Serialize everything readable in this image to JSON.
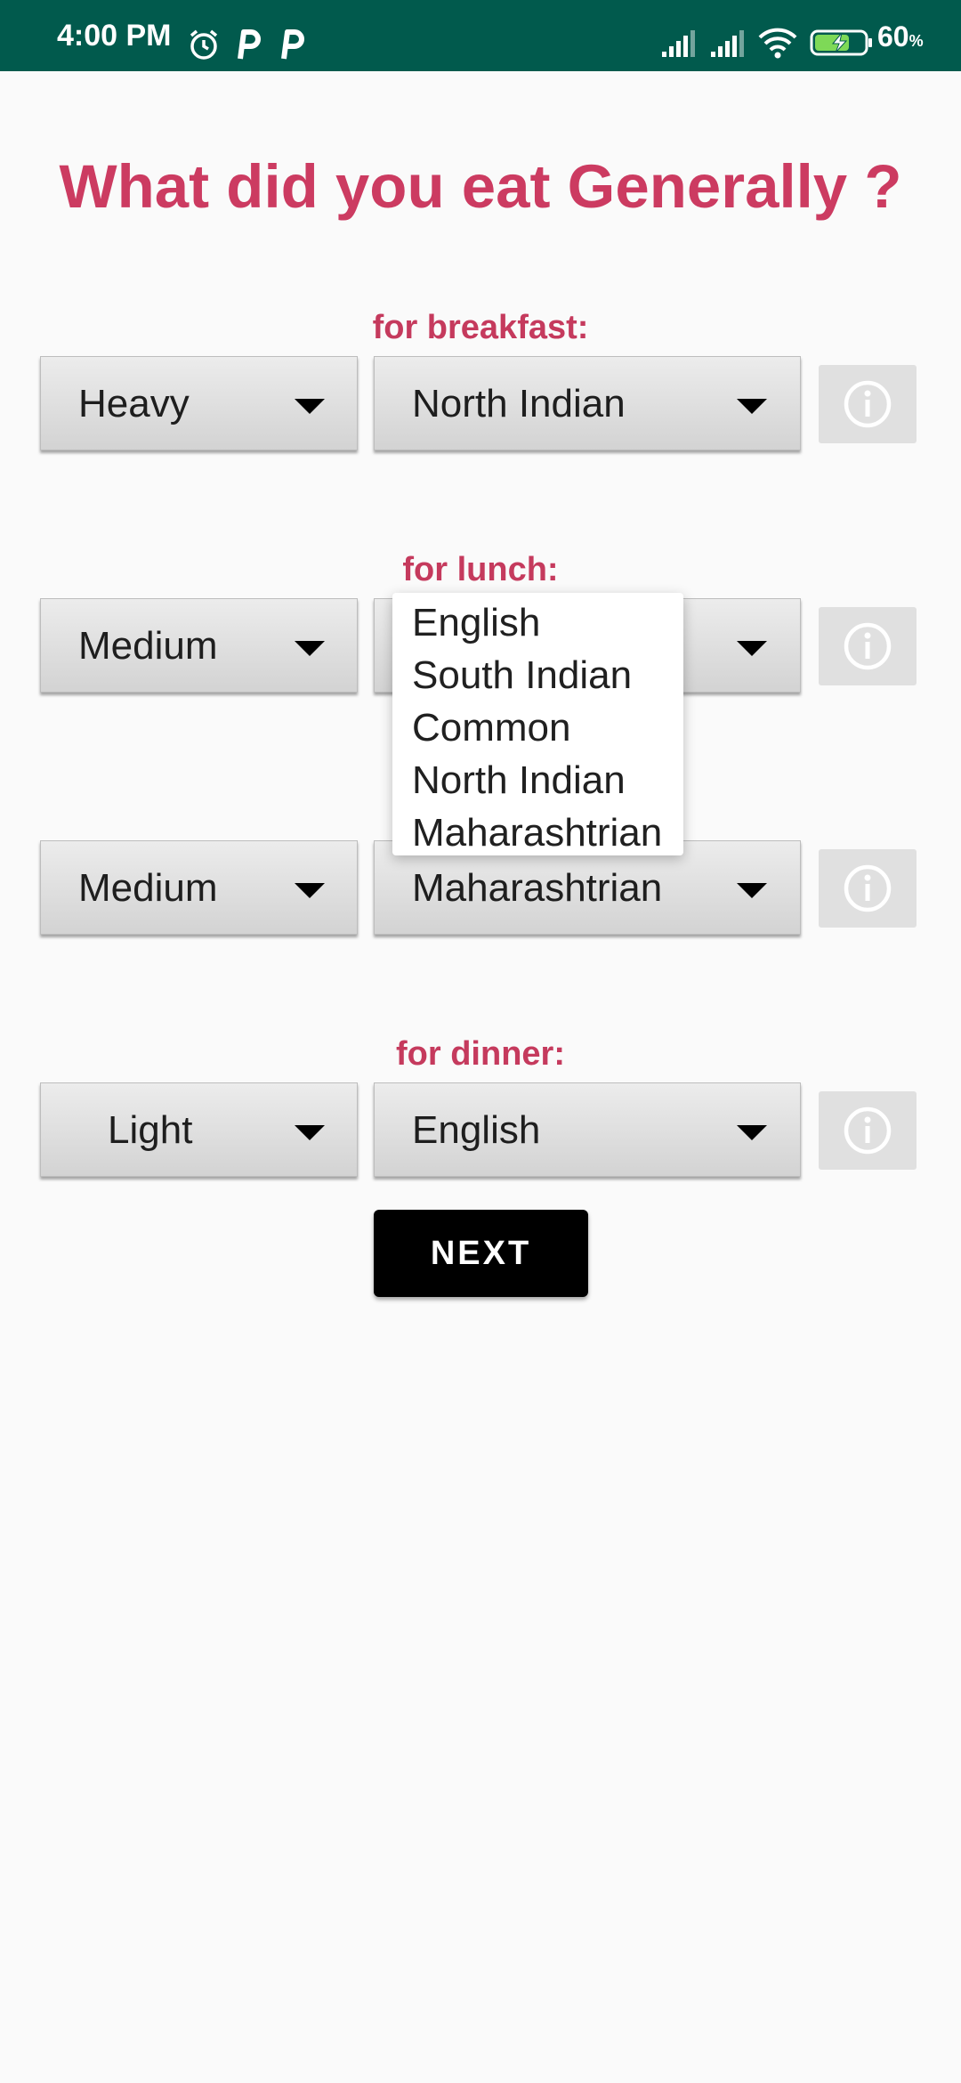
{
  "status_bar": {
    "time": "4:00 PM",
    "battery_value": "60",
    "battery_unit": "%",
    "icons": [
      "alarm-icon",
      "p-notification-icon",
      "p-notification-icon",
      "cell-signal-icon",
      "cell-signal-icon",
      "wifi-icon",
      "battery-charging-icon"
    ],
    "background": "#015a4d"
  },
  "title": "What did you eat Generally ?",
  "accent_color": "#cc3b61",
  "rows": [
    {
      "label": "for breakfast:",
      "amount": "Heavy",
      "cuisine": "North Indian"
    },
    {
      "label": "for lunch:",
      "amount": "Medium",
      "cuisine": ""
    },
    {
      "label": "",
      "amount": "Medium",
      "cuisine": "Maharashtrian"
    },
    {
      "label": "for dinner:",
      "amount": "Light",
      "cuisine": "English"
    }
  ],
  "dropdown": {
    "options": [
      "English",
      "South Indian",
      "Common",
      "North Indian",
      "Maharashtrian"
    ]
  },
  "next_button": "NEXT"
}
